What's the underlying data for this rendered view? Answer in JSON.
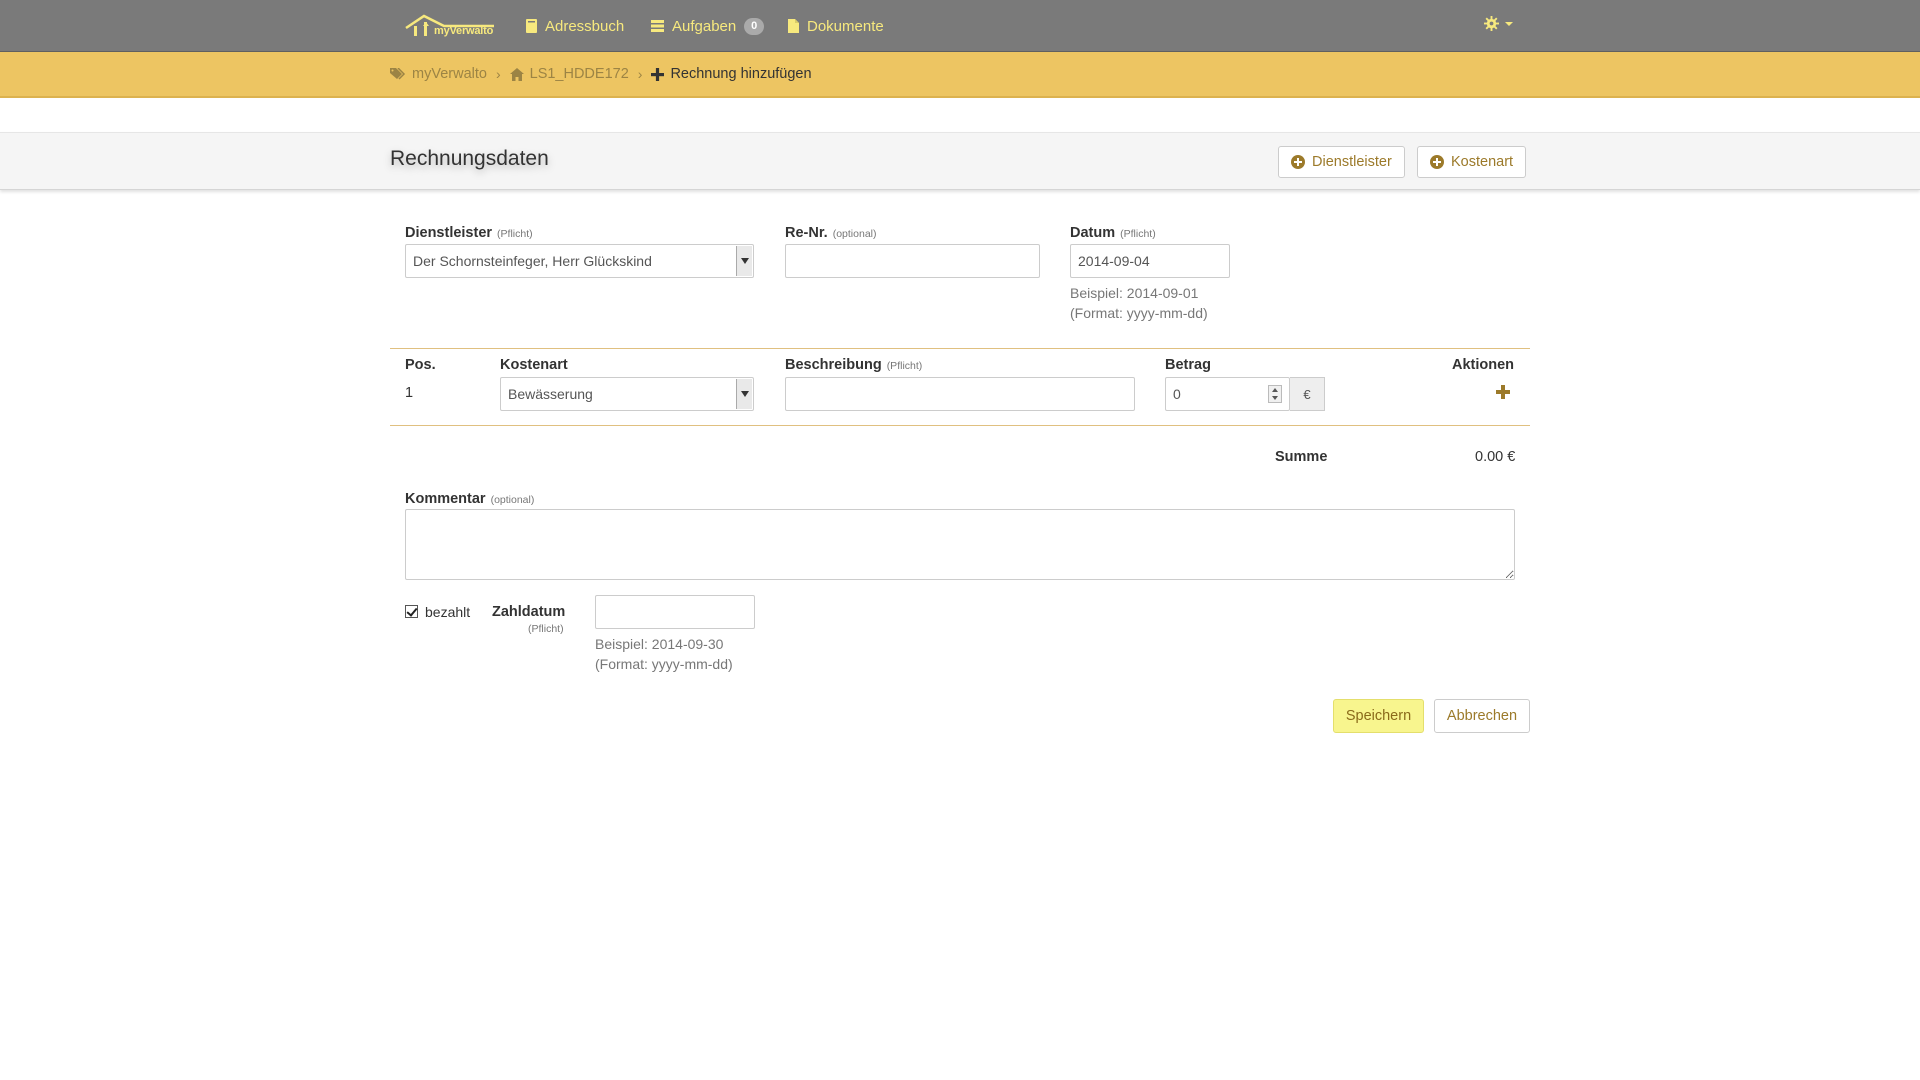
{
  "navbar": {
    "brand": "myVerwalto",
    "items": [
      {
        "label": "Adressbuch",
        "icon": "book-icon"
      },
      {
        "label": "Aufgaben",
        "icon": "tasks-icon",
        "badge": "0"
      },
      {
        "label": "Dokumente",
        "icon": "document-icon"
      }
    ],
    "settings_icon": "gear-icon"
  },
  "breadcrumb": [
    {
      "label": "myVerwalto",
      "icon": "tags-icon"
    },
    {
      "label": "LS1_HDDE172",
      "icon": "home-icon"
    },
    {
      "label": "Rechnung hinzufügen",
      "icon": "plus-icon"
    }
  ],
  "header": {
    "title": "Rechnungsdaten",
    "buttons": [
      "Dienstleister",
      "Kostenart"
    ]
  },
  "form": {
    "dienstleister": {
      "label": "Dienstleister",
      "tag": "(Pflicht)",
      "value": "Der Schornsteinfeger, Herr Glückskind"
    },
    "renr": {
      "label": "Re-Nr.",
      "tag": "(optional)",
      "value": ""
    },
    "datum": {
      "label": "Datum",
      "tag": "(Pflicht)",
      "value": "2014-09-04",
      "hint_example": "Beispiel: 2014-09-01",
      "hint_format": "(Format: yyyy-mm-dd)"
    },
    "positions": {
      "headers": {
        "pos": "Pos.",
        "kostenart": "Kostenart",
        "beschreibung": "Beschreibung",
        "beschreibung_tag": "(Pflicht)",
        "betrag": "Betrag",
        "aktionen": "Aktionen"
      },
      "rows": [
        {
          "pos": "1",
          "kostenart": "Bewässerung",
          "beschreibung": "",
          "betrag": "0",
          "currency": "€"
        }
      ]
    },
    "summe": {
      "label": "Summe",
      "value": "0.00 €"
    },
    "kommentar": {
      "label": "Kommentar",
      "tag": "(optional)",
      "value": ""
    },
    "bezahlt": {
      "label": "bezahlt",
      "checked": true
    },
    "zahldatum": {
      "label": "Zahldatum",
      "tag": "(Pflicht)",
      "value": "",
      "hint_example": "Beispiel: 2014-09-30",
      "hint_format": "(Format: yyyy-mm-dd)"
    }
  },
  "actions": {
    "save": "Speichern",
    "cancel": "Abbrechen"
  },
  "colors": {
    "navbar": "#7a7a7a",
    "breadcrumb_bar": "#edc562",
    "accent": "#9c7a2a",
    "nav_text": "#f7e97e",
    "save_button": "#f8f58e"
  }
}
